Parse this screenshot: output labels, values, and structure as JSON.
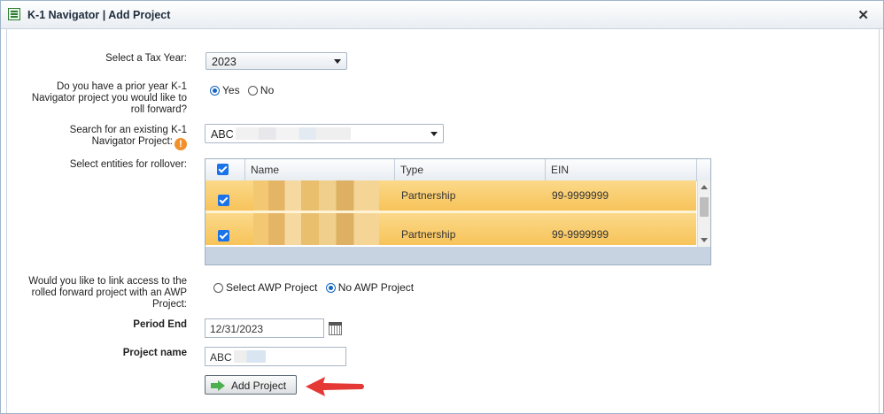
{
  "window": {
    "title": "K-1 Navigator | Add Project",
    "close_glyph": "✕"
  },
  "tax_year": {
    "label": "Select a Tax Year:",
    "value": "2023"
  },
  "prior_year": {
    "label_lines": [
      "Do you have a prior year K-1",
      "Navigator project you would like to",
      "roll forward?"
    ],
    "options": [
      {
        "label": "Yes",
        "selected": true
      },
      {
        "label": "No",
        "selected": false
      }
    ]
  },
  "search_project": {
    "label_lines": [
      "Search for an existing K-1",
      "Navigator Project:"
    ],
    "info_glyph": "!",
    "value": "ABC"
  },
  "entities": {
    "label": "Select entities for rollover:",
    "columns": [
      "Name",
      "Type",
      "EIN"
    ],
    "rows": [
      {
        "checked": true,
        "name": "",
        "type": "Partnership",
        "ein": "99-9999999"
      },
      {
        "checked": true,
        "name": "",
        "type": "Partnership",
        "ein": "99-9999999"
      }
    ]
  },
  "awp": {
    "label_lines": [
      "Would you like to link access to the",
      "rolled forward project with an AWP",
      "Project:"
    ],
    "options": [
      {
        "label": "Select AWP Project",
        "selected": false
      },
      {
        "label": "No AWP Project",
        "selected": true
      }
    ]
  },
  "period_end": {
    "label": "Period End",
    "value": "12/31/2023"
  },
  "project_name": {
    "label": "Project name",
    "value": "ABC"
  },
  "add_button": {
    "label": "Add Project"
  },
  "colors": {
    "accent": "#1565c0",
    "row_highlight": "#f7c35a",
    "annotation_arrow": "#e53935"
  }
}
